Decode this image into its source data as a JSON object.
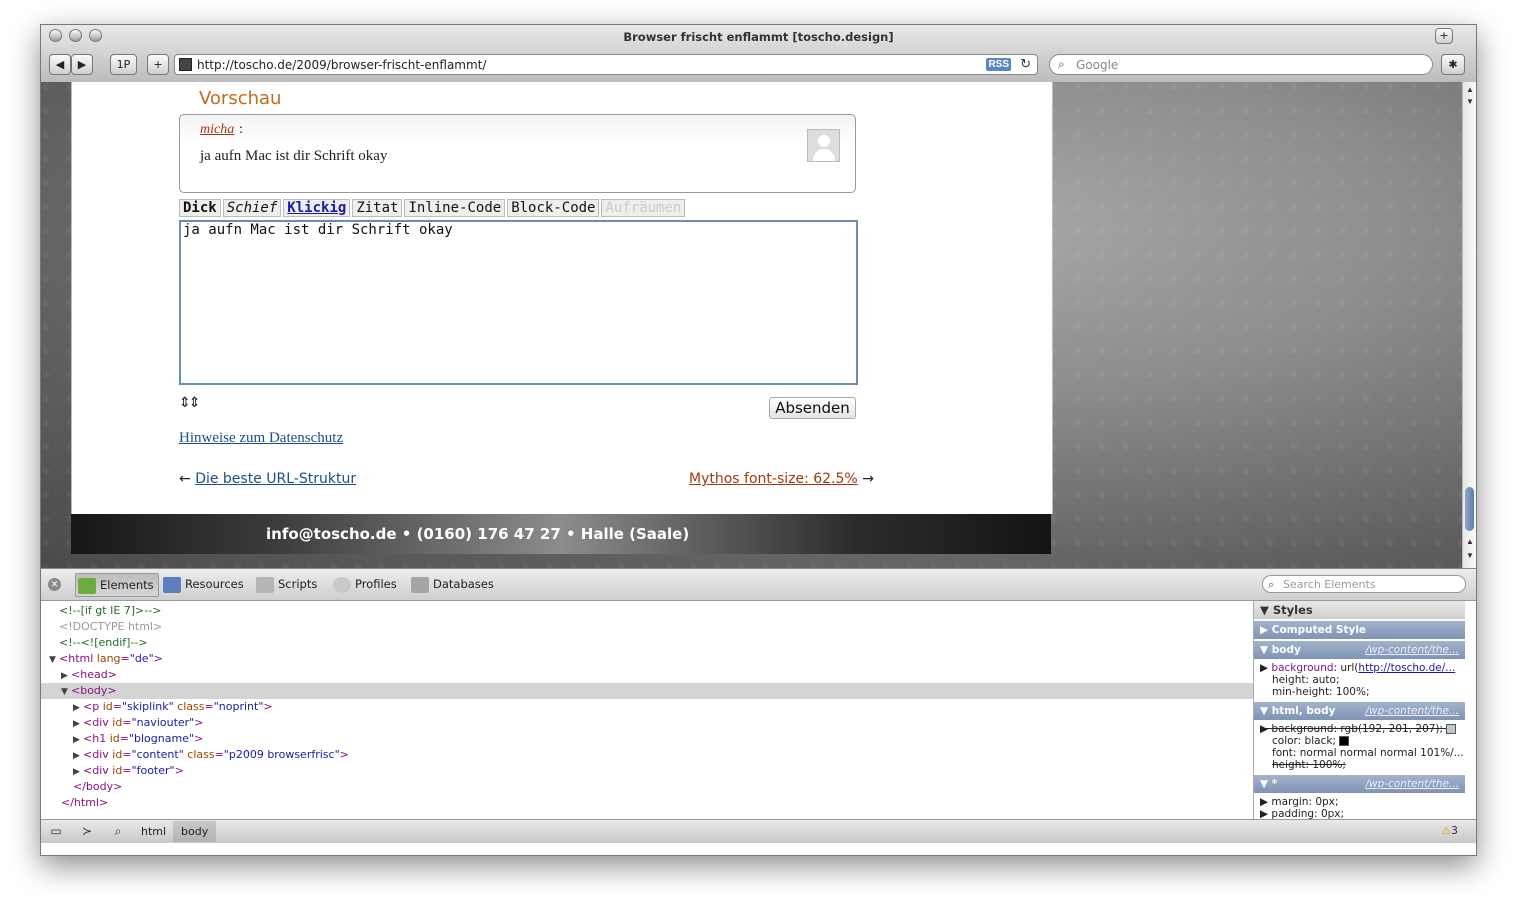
{
  "window": {
    "title": "Browser frischt enflammt [toscho.design]"
  },
  "toolbar": {
    "back_icon": "back-arrow-icon",
    "forward_icon": "forward-arrow-icon",
    "onepassword_label": "1P",
    "add_label": "+",
    "url": "http://toscho.de/2009/browser-frischt-enflammt/",
    "rss_label": "RSS",
    "search_placeholder": "Google"
  },
  "page": {
    "preview_title": "Vorschau",
    "comment": {
      "author": "micha",
      "text": "ja aufn Mac ist dir Schrift okay"
    },
    "format_buttons": [
      "Dick",
      "Schief",
      "Klickig",
      "Zitat",
      "Inline-Code",
      "Block-Code",
      "Aufräumen"
    ],
    "textarea_value": "ja aufn Mac ist dir Schrift okay",
    "submit_label": "Absenden",
    "privacy_link": "Hinweise zum Datenschutz",
    "prev_arrow": "←",
    "prev_link": "Die beste URL-Struktur",
    "next_link": "Mythos font-size: 62.5%",
    "next_arrow": "→",
    "footer_text": "info@toscho.de • (0160) 176 47 27 • Halle (Saale)"
  },
  "devtools": {
    "tabs": [
      "Elements",
      "Resources",
      "Scripts",
      "Profiles",
      "Databases"
    ],
    "search_placeholder": "Search Elements",
    "dom": {
      "l1": "<!--[if gt IE 7]>-->",
      "l2": "<!DOCTYPE html>",
      "l3": "<!--<![endif]-->",
      "l4_tag": "<html",
      "l4_attr": "lang",
      "l4_val": "\"de\"",
      "l5": "<head>",
      "l6": "<body>",
      "l7_attr1": "id",
      "l7_val1": "\"skiplink\"",
      "l7_attr2": "class",
      "l7_val2": "\"noprint\"",
      "l8_val": "\"naviouter\"",
      "l9_val": "\"blogname\"",
      "l10_val1": "\"content\"",
      "l10_val2": "\"p2009 browserfrisc\"",
      "l11_val": "\"footer\"",
      "l12": "</body>",
      "l13": "</html>"
    },
    "styles": {
      "header": "Styles",
      "computed": "Computed Style",
      "rule1_selector": "body",
      "rule1_source": "/wp-content/the...",
      "rule1_bg_key": "background",
      "rule1_bg_val": "url(",
      "rule1_bg_link": "http://toscho.de/...",
      "rule1_height": "height: auto;",
      "rule1_minheight": "min-height: 100%;",
      "rule2_selector": "html, body",
      "rule2_source": "/wp-content/the...",
      "rule2_bg": "background: rgb(192, 201, 207);",
      "rule2_color": "color: black;",
      "rule2_font": "font: normal normal normal 101%/...",
      "rule2_height": "height: 100%;",
      "rule3_selector": "*",
      "rule3_source": "/wp-content/the...",
      "rule3_margin": "margin: 0px;",
      "rule3_padding": "padding: 0px;"
    },
    "breadcrumbs": [
      "html",
      "body"
    ],
    "warnings_count": "3"
  },
  "colors": {
    "accent_orange": "#c46a1a",
    "link_blue": "#1a4f87",
    "selection_blue": "#7f93b6"
  }
}
